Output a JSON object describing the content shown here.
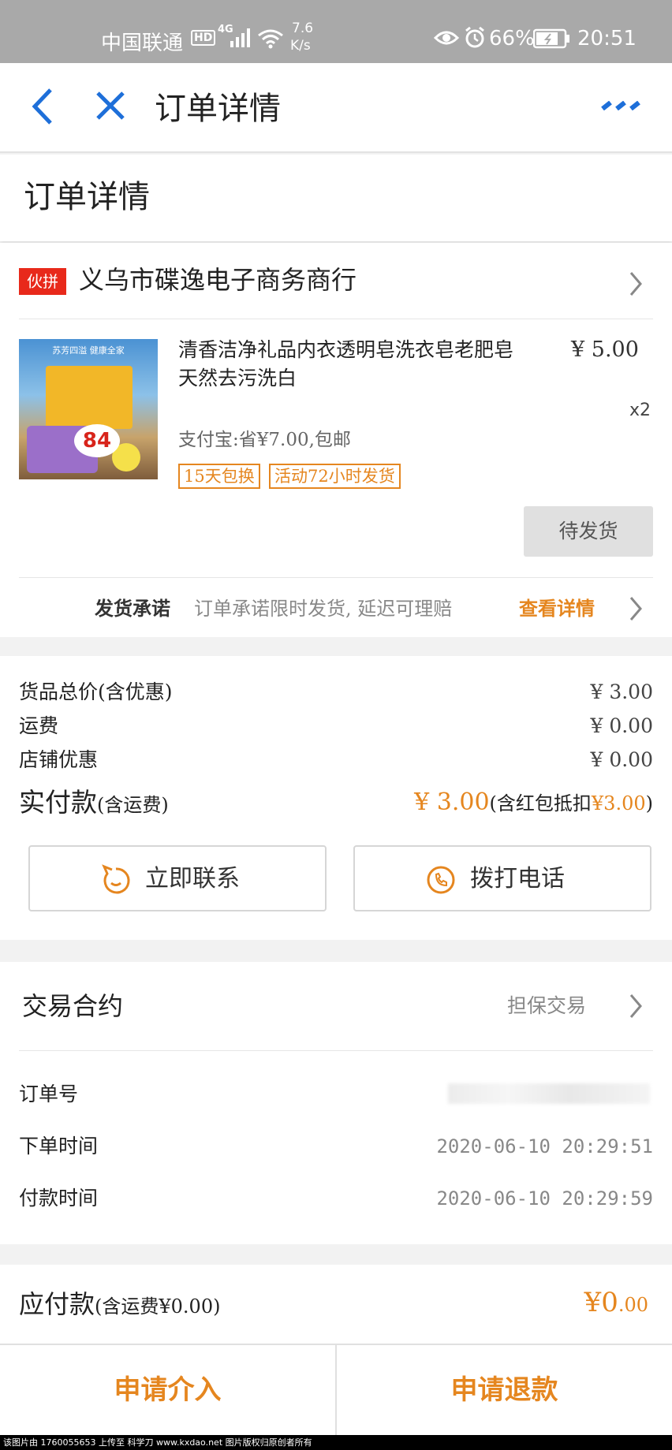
{
  "status_bar": {
    "carrier": "中国联通",
    "hd": "HD",
    "network": "4G",
    "speed_value": "7.6",
    "speed_unit": "K/s",
    "battery": "66%",
    "time": "20:51"
  },
  "nav": {
    "title": "订单详情"
  },
  "header": {
    "title": "订单详情"
  },
  "shop": {
    "badge": "伙拼",
    "name": "义乌市碟逸电子商务商行"
  },
  "product": {
    "title_line1": "清香洁净礼品内衣透明皂洗衣皂老肥皂",
    "title_line2": "天然去污洗白",
    "price": "¥ 5.00",
    "quantity": "x2",
    "promo": "支付宝:省¥7.00,包邮",
    "tags": [
      "15天包换",
      "活动72小时发货"
    ],
    "image_text_top": "苏芳四溢 健康全家",
    "image_text_big": "84",
    "status_button": "待发货"
  },
  "promise": {
    "label": "发货承诺",
    "desc": "订单承诺限时发货, 延迟可理赔",
    "link": "查看详情"
  },
  "costs": {
    "rows": [
      {
        "label": "货品总价(含优惠)",
        "value": "¥ 3.00"
      },
      {
        "label": "运费",
        "value": "¥ 0.00"
      },
      {
        "label": "店铺优惠",
        "value": "¥ 0.00"
      }
    ],
    "paid_label": "实付款",
    "paid_note": "(含运费)",
    "paid_value": "¥ 3.00",
    "paid_extra_prefix": "(含红包抵扣",
    "paid_extra_value": "¥3.00",
    "paid_extra_suffix": ")"
  },
  "contact": {
    "chat_label": "立即联系",
    "call_label": "拨打电话"
  },
  "contract": {
    "title": "交易合约",
    "value": "担保交易",
    "rows": [
      {
        "label": "订单号",
        "value": ""
      },
      {
        "label": "下单时间",
        "value": "2020-06-10 20:29:51"
      },
      {
        "label": "付款时间",
        "value": "2020-06-10 20:29:59"
      }
    ]
  },
  "due": {
    "label": "应付款",
    "note": "(含运费¥0.00)",
    "value_main": "¥0",
    "value_dec": ".00"
  },
  "actions": {
    "intervene": "申请介入",
    "refund": "申请退款"
  },
  "watermark": "该图片由 1760055653 上传至 科学刀 www.kxdao.net 图片版权归原创者所有",
  "colors": {
    "accent": "#e5861f",
    "nav_blue": "#1e6fd9",
    "badge_red": "#e8291b"
  }
}
